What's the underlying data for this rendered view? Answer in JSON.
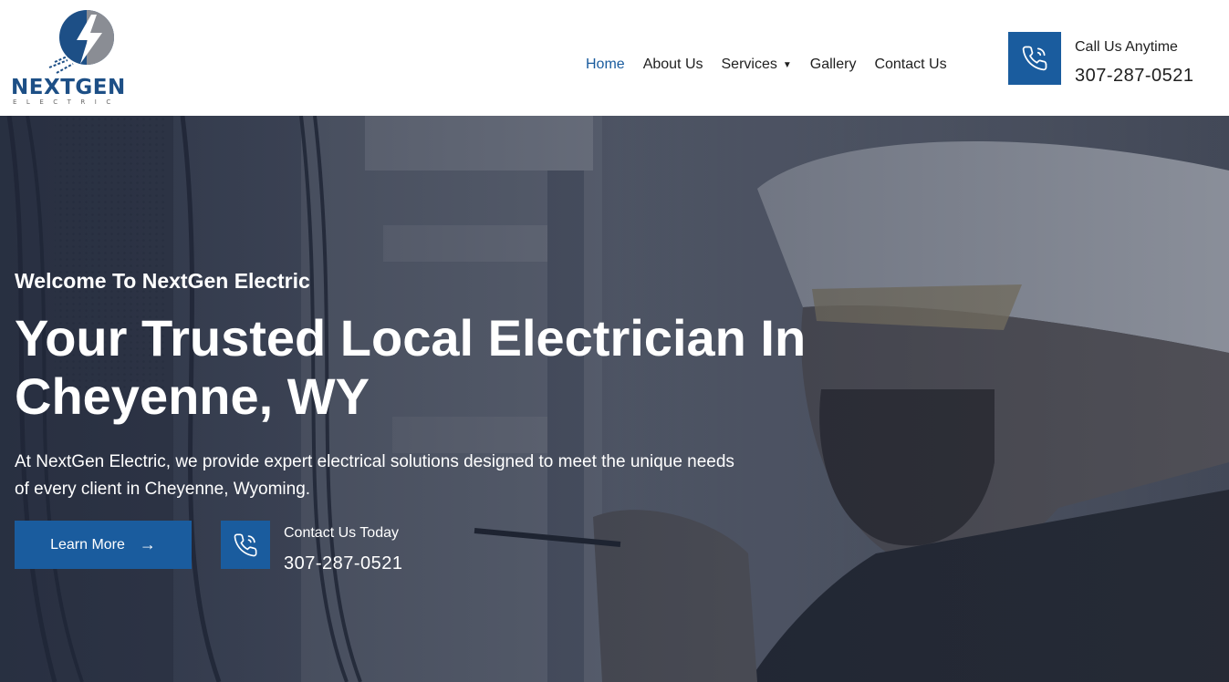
{
  "brand": {
    "name": "NEXTGEN",
    "tagline": "ELECTRIC",
    "primary_color": "#1a5c9e",
    "logo_icon": "lightning-bolt-circle-icon"
  },
  "nav": {
    "items": [
      {
        "label": "Home",
        "active": true
      },
      {
        "label": "About Us",
        "active": false
      },
      {
        "label": "Services",
        "active": false,
        "has_dropdown": true
      },
      {
        "label": "Gallery",
        "active": false
      },
      {
        "label": "Contact Us",
        "active": false
      }
    ]
  },
  "header_call": {
    "icon": "phone-icon",
    "label": "Call Us Anytime",
    "number": "307-287-0521"
  },
  "hero": {
    "welcome": "Welcome To NextGen Electric",
    "title": "Your Trusted Local Electrician In Cheyenne, WY",
    "description": "At NextGen Electric, we provide expert electrical solutions designed to meet the unique needs of every client in Cheyenne, Wyoming.",
    "cta_label": "Learn More",
    "cta_icon": "arrow-right-icon",
    "contact_icon": "phone-icon",
    "contact_label": "Contact Us Today",
    "contact_number": "307-287-0521"
  }
}
